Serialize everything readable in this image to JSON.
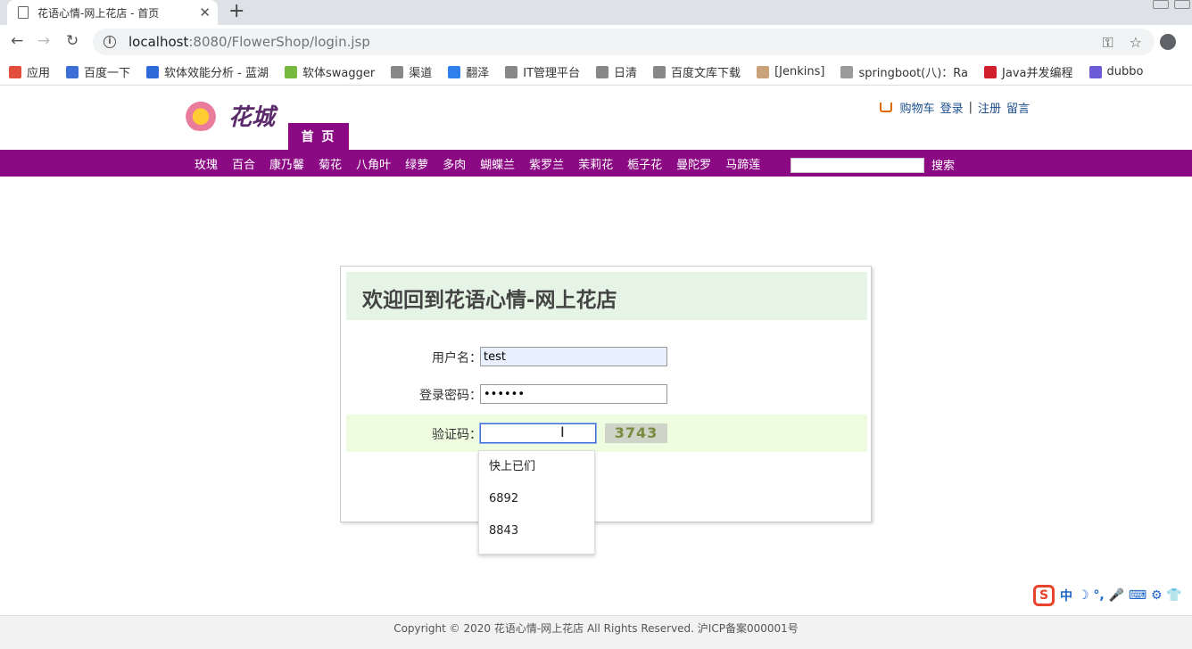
{
  "browser": {
    "tab_title": "花语心情-网上花店 - 首页",
    "tab_close": "✕",
    "new_tab": "+",
    "url_host": "localhost",
    "url_path": ":8080/FlowerShop/login.jsp",
    "bookmarks": [
      {
        "label": "应用",
        "color": "#e24d3c"
      },
      {
        "label": "百度一下",
        "color": "#3b6fd6"
      },
      {
        "label": "软体效能分析 - 蓝湖",
        "color": "#2e6bd8"
      },
      {
        "label": "软体swagger",
        "color": "#76b93f"
      },
      {
        "label": "渠道",
        "color": "#888888"
      },
      {
        "label": "翻泽",
        "color": "#2f80ed"
      },
      {
        "label": "IT管理平台",
        "color": "#888888"
      },
      {
        "label": "日清",
        "color": "#888888"
      },
      {
        "label": "百度文库下载",
        "color": "#888888"
      },
      {
        "label": "[Jenkins]",
        "color": "#c9a27a"
      },
      {
        "label": "springboot(八)：Ra",
        "color": "#9a9a9a"
      },
      {
        "label": "Java并发编程",
        "color": "#d0202c"
      },
      {
        "label": "dubbo",
        "color": "#6b5bd6"
      }
    ]
  },
  "site": {
    "logo_text": "花城",
    "top_links": {
      "cart": "购物车",
      "login": "登录",
      "separator": "|",
      "register": "注册",
      "message": "留言"
    },
    "home_tab": "首 页",
    "categories": [
      "玫瑰",
      "百合",
      "康乃馨",
      "菊花",
      "八角叶",
      "绿萝",
      "多肉",
      "蝴蝶兰",
      "紫罗兰",
      "茉莉花",
      "栀子花",
      "曼陀罗",
      "马蹄莲"
    ],
    "search_label": "搜索",
    "search_value": ""
  },
  "login": {
    "heading": "欢迎回到花语心情-网上花店",
    "username_label": "用户名：",
    "username_value": "test",
    "password_label": "登录密码：",
    "password_value": "••••••",
    "code_label": "验证码：",
    "code_value": "",
    "captcha_text": "3743"
  },
  "autocomplete": [
    "快上已们",
    "6892",
    "8843"
  ],
  "ime": {
    "mode": "中",
    "glyphs": "☽ °, 🎤 ⌨ ⚙ 👕"
  },
  "footer": {
    "text": "Copyright © 2020 花语心情-网上花店 All Rights Reserved. 沪ICP备案000001号"
  },
  "colors": {
    "nav_purple": "#8b0a84",
    "login_head": "#e6f4e6",
    "code_row": "#eefde0"
  }
}
